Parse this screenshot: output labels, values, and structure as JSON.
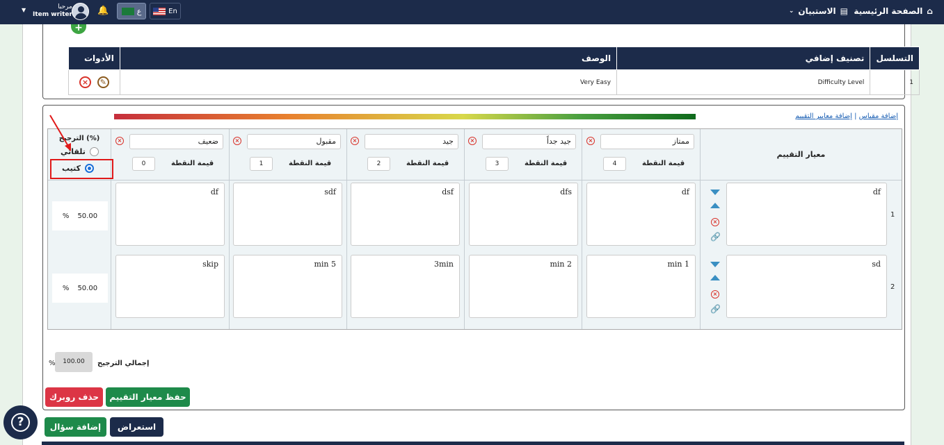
{
  "topbar": {
    "home_label": "الصفحة الرئيسية",
    "survey_label": "الاستبيان",
    "lang_en": "En",
    "lang_ar": "ع",
    "greeting": "مرحبا",
    "username": "Item writer"
  },
  "classification_table": {
    "headers": [
      "التسلسل",
      "تصنيف إضافي",
      "الوصف",
      "الأدوات"
    ],
    "rows": [
      {
        "seq": "1",
        "classification": "Difficulty Level",
        "description": "Very Easy"
      }
    ]
  },
  "rubric": {
    "links": {
      "add_scale": "إضافة مقياس",
      "separator": "|",
      "add_criteria": "إضافة معايير التقييم"
    },
    "criteria_header": "معيار التقييم",
    "points_label": "قيمة النقطة",
    "levels": [
      {
        "name": "ممتاز",
        "points": "4"
      },
      {
        "name": "جيد جداً",
        "points": "3"
      },
      {
        "name": "جيد",
        "points": "2"
      },
      {
        "name": "مقبول",
        "points": "1"
      },
      {
        "name": "ضعيف",
        "points": "0"
      }
    ],
    "weight": {
      "title": "(%) الترجيح",
      "options": [
        {
          "label": "تلقائي",
          "selected": false
        },
        {
          "label": "كتيب",
          "selected": true
        }
      ]
    },
    "rows": [
      {
        "num": "1",
        "criterion": "df",
        "cells": [
          "df",
          "dfs",
          "dsf",
          "sdf",
          "df"
        ],
        "weight": "50.00",
        "pct": "%"
      },
      {
        "num": "2",
        "criterion": "sd",
        "cells": [
          "min 1",
          "min 2",
          "3min",
          "min 5",
          "skip"
        ],
        "weight": "50.00",
        "pct": "%"
      }
    ],
    "total_label": "إجمالي الترجيح",
    "total_value": "100.00",
    "total_pct": "%"
  },
  "buttons": {
    "save_criteria": "حفظ معيار التقييم",
    "delete_rubric": "حذف روبرك",
    "preview": "استعراض",
    "add_question": "إضافة سؤال"
  },
  "colors": {
    "navy": "#1c2b4a",
    "green": "#1e8a4a",
    "red": "#dc3545",
    "accent_blue": "#3a8fc2"
  }
}
